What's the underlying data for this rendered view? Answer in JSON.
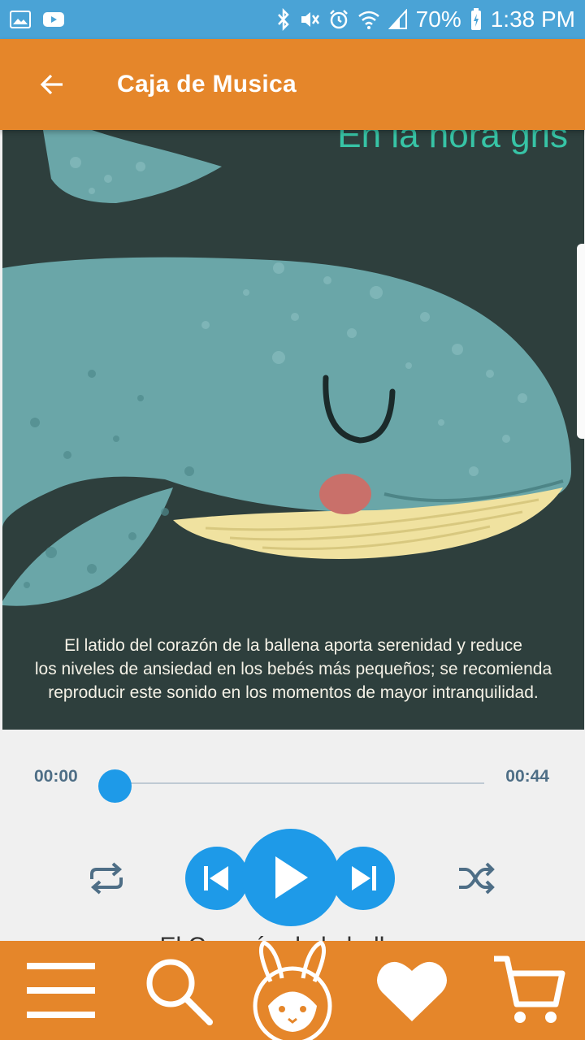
{
  "status_bar": {
    "battery": "70%",
    "time": "1:38 PM",
    "icons": [
      "image-icon",
      "youtube-icon",
      "bluetooth-icon",
      "mute-icon",
      "alarm-icon",
      "wifi-icon",
      "signal-icon",
      "battery-icon"
    ]
  },
  "app_bar": {
    "title": "Caja de Musica",
    "back_icon": "arrow-left-icon"
  },
  "artwork": {
    "heading": "En la hora gris",
    "caption_lines": [
      "El latido del corazón de la ballena aporta serenidad y reduce",
      "los niveles de ansiedad en los bebés más pequeños; se recomienda",
      "reproducir este sonido en los momentos de mayor intranquilidad."
    ]
  },
  "player": {
    "current_time": "00:00",
    "total_time": "00:44",
    "progress": 0,
    "track_title": "El Corazón de la ballena",
    "controls": [
      "repeat-icon",
      "previous-icon",
      "play-icon",
      "next-icon",
      "shuffle-icon"
    ]
  },
  "bottom_nav": {
    "items": [
      "menu-icon",
      "search-icon",
      "bunny-logo-icon",
      "heart-icon",
      "cart-icon"
    ]
  },
  "colors": {
    "status_bar": "#4aa3d6",
    "brand_orange": "#e5862a",
    "accent_blue": "#1e9ae8",
    "artwork_bg": "#2e3f3d",
    "whale": "#6aa6a8"
  }
}
